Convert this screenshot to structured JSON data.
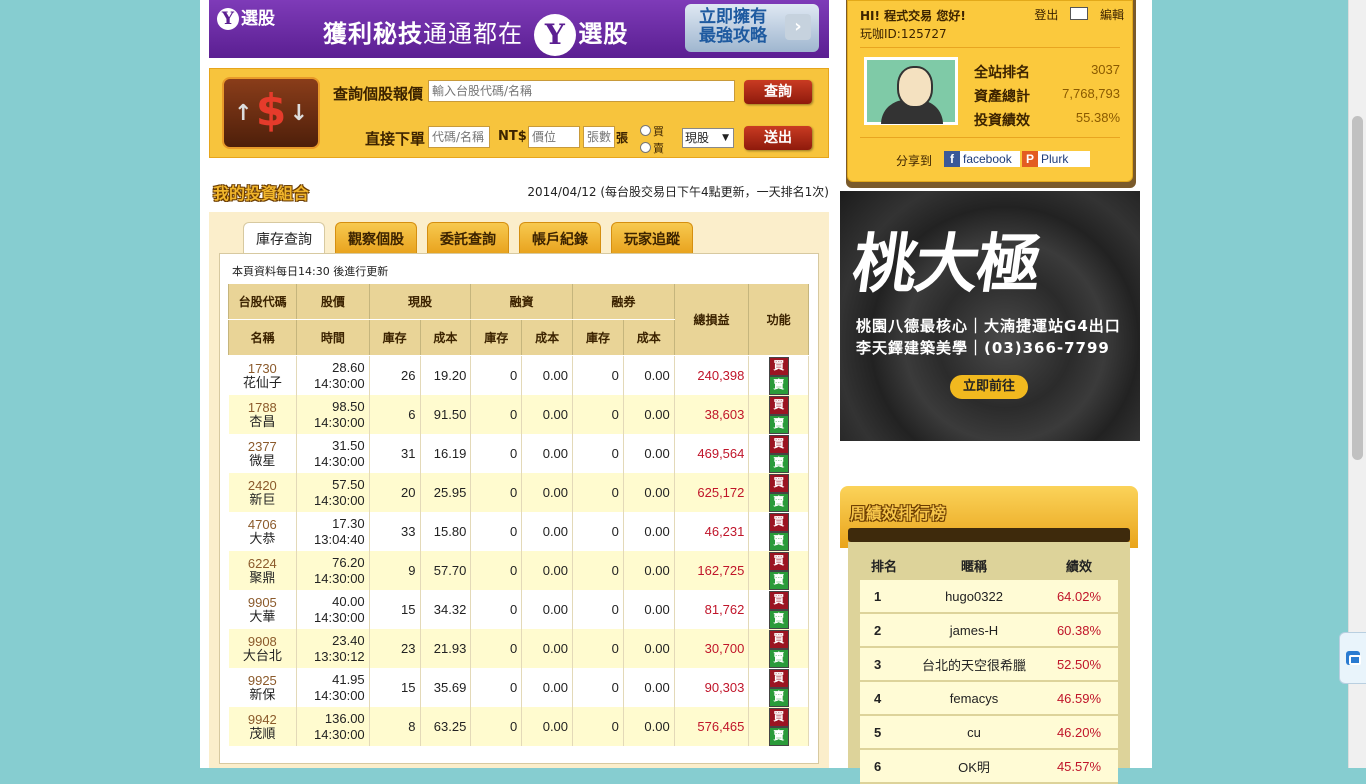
{
  "banner": {
    "logo_text": "選股",
    "slogan_bold": "獲利秘技",
    "slogan_thin": "通通都在",
    "slogan_brand": "選股",
    "cta_line1": "立即擁有",
    "cta_line2": "最強攻略"
  },
  "quote": {
    "quote_label": "查詢個股報價",
    "quote_placeholder": "輸入台股代碼/名稱",
    "quote_button": "查詢",
    "order_label": "直接下單",
    "code_placeholder": "代碼/名稱",
    "currency_label": "NT$",
    "price_placeholder": "價位",
    "shares_placeholder": "張數",
    "unit_label": "張",
    "buy_radio": "買",
    "sell_radio": "賣",
    "order_type": "現股",
    "submit_button": "送出"
  },
  "portfolio": {
    "title": "我的投資組合",
    "date_note": "2014/04/12 (每台股交易日下午4點更新，一天排名1次)",
    "tabs": [
      "庫存查詢",
      "觀察個股",
      "委託查詢",
      "帳戶紀錄",
      "玩家追蹤"
    ],
    "active_tab": 0,
    "update_note": "本頁資料每日14:30 後進行更新",
    "headers": {
      "code": "台股代碼",
      "price": "股價",
      "cash": "現股",
      "margin": "融資",
      "short": "融券",
      "pnl": "總損益",
      "func": "功能",
      "name": "名稱",
      "time": "時間",
      "hold": "庫存",
      "cost": "成本"
    },
    "buy_label": "買",
    "sell_label": "賣",
    "rows": [
      {
        "code": "1730",
        "name": "花仙子",
        "price": "28.60",
        "time": "14:30:00",
        "cash_hold": "26",
        "cash_cost": "19.20",
        "margin_hold": "0",
        "margin_cost": "0.00",
        "short_hold": "0",
        "short_cost": "0.00",
        "pnl": "240,398"
      },
      {
        "code": "1788",
        "name": "杏昌",
        "price": "98.50",
        "time": "14:30:00",
        "cash_hold": "6",
        "cash_cost": "91.50",
        "margin_hold": "0",
        "margin_cost": "0.00",
        "short_hold": "0",
        "short_cost": "0.00",
        "pnl": "38,603"
      },
      {
        "code": "2377",
        "name": "微星",
        "price": "31.50",
        "time": "14:30:00",
        "cash_hold": "31",
        "cash_cost": "16.19",
        "margin_hold": "0",
        "margin_cost": "0.00",
        "short_hold": "0",
        "short_cost": "0.00",
        "pnl": "469,564"
      },
      {
        "code": "2420",
        "name": "新巨",
        "price": "57.50",
        "time": "14:30:00",
        "cash_hold": "20",
        "cash_cost": "25.95",
        "margin_hold": "0",
        "margin_cost": "0.00",
        "short_hold": "0",
        "short_cost": "0.00",
        "pnl": "625,172"
      },
      {
        "code": "4706",
        "name": "大恭",
        "price": "17.30",
        "time": "13:04:40",
        "cash_hold": "33",
        "cash_cost": "15.80",
        "margin_hold": "0",
        "margin_cost": "0.00",
        "short_hold": "0",
        "short_cost": "0.00",
        "pnl": "46,231"
      },
      {
        "code": "6224",
        "name": "聚鼎",
        "price": "76.20",
        "time": "14:30:00",
        "cash_hold": "9",
        "cash_cost": "57.70",
        "margin_hold": "0",
        "margin_cost": "0.00",
        "short_hold": "0",
        "short_cost": "0.00",
        "pnl": "162,725"
      },
      {
        "code": "9905",
        "name": "大華",
        "price": "40.00",
        "time": "14:30:00",
        "cash_hold": "15",
        "cash_cost": "34.32",
        "margin_hold": "0",
        "margin_cost": "0.00",
        "short_hold": "0",
        "short_cost": "0.00",
        "pnl": "81,762"
      },
      {
        "code": "9908",
        "name": "大台北",
        "price": "23.40",
        "time": "13:30:12",
        "cash_hold": "23",
        "cash_cost": "21.93",
        "margin_hold": "0",
        "margin_cost": "0.00",
        "short_hold": "0",
        "short_cost": "0.00",
        "pnl": "30,700"
      },
      {
        "code": "9925",
        "name": "新保",
        "price": "41.95",
        "time": "14:30:00",
        "cash_hold": "15",
        "cash_cost": "35.69",
        "margin_hold": "0",
        "margin_cost": "0.00",
        "short_hold": "0",
        "short_cost": "0.00",
        "pnl": "90,303"
      },
      {
        "code": "9942",
        "name": "茂順",
        "price": "136.00",
        "time": "14:30:00",
        "cash_hold": "8",
        "cash_cost": "63.25",
        "margin_hold": "0",
        "margin_cost": "0.00",
        "short_hold": "0",
        "short_cost": "0.00",
        "pnl": "576,465"
      }
    ]
  },
  "user": {
    "greeting": "HI! 程式交易  您好!",
    "player_id": "玩咖ID:125727",
    "logout": "登出",
    "edit": "編輯",
    "stats": [
      {
        "label": "全站排名",
        "value": "3037"
      },
      {
        "label": "資產總計",
        "value": "7,768,793"
      },
      {
        "label": "投資績效",
        "value": "55.38%"
      }
    ],
    "share_label": "分享到",
    "facebook": "facebook",
    "plurk": "Plurk"
  },
  "ad": {
    "brand": "桃大極",
    "line1": "桃園八德最核心｜大湳捷運站G4出口",
    "line2": "李天鐸建築美學｜(03)366-7799",
    "button": "立即前往"
  },
  "ranking": {
    "title": "周績效排行榜",
    "headers": [
      "排名",
      "暱稱",
      "績效"
    ],
    "rows": [
      {
        "rank": "1",
        "name": "hugo0322",
        "perf": "64.02%"
      },
      {
        "rank": "2",
        "name": "james-H",
        "perf": "60.38%"
      },
      {
        "rank": "3",
        "name": "台北的天空很希臘",
        "perf": "52.50%"
      },
      {
        "rank": "4",
        "name": "femacys",
        "perf": "46.59%"
      },
      {
        "rank": "5",
        "name": "cu",
        "perf": "46.20%"
      },
      {
        "rank": "6",
        "name": "OK明",
        "perf": "45.57%"
      }
    ]
  },
  "colors": {
    "page_bg": "#86cdd0",
    "gold": "#f7c43d",
    "loss_red": "#c0152a",
    "buy": "#9b1422",
    "sell": "#2a9b3a"
  }
}
